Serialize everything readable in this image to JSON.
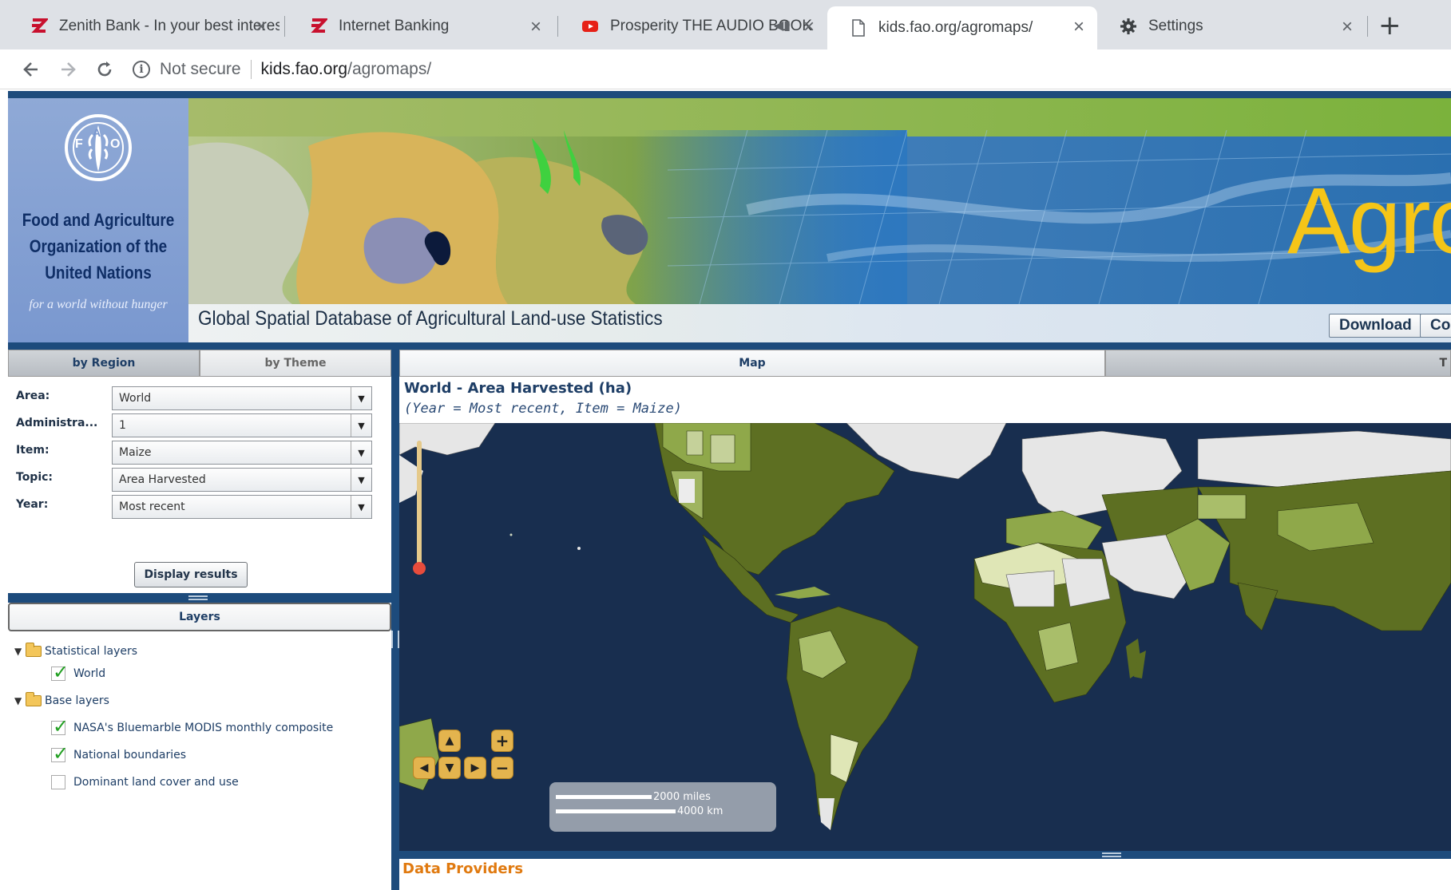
{
  "browser": {
    "tabs": [
      {
        "title": "Zenith Bank - In your best interes",
        "icon": "zenith-z-icon"
      },
      {
        "title": "Internet Banking",
        "icon": "zenith-z-icon"
      },
      {
        "title": "Prosperity THE AUDIO BOOK",
        "icon": "youtube-icon"
      },
      {
        "title": "kids.fao.org/agromaps/",
        "icon": "page-icon"
      },
      {
        "title": "Settings",
        "icon": "gear-icon"
      }
    ],
    "new_tab": "+",
    "security_label": "Not secure",
    "url_host": "kids.fao.org",
    "url_path": "/agromaps/"
  },
  "header": {
    "org_name_line1": "Food and Agriculture",
    "org_name_line2": "Organization of the",
    "org_name_line3": "United Nations",
    "tagline": "for a world without hunger",
    "logo_text": "FAO",
    "site_title_partial": "Agro",
    "subtitle": "Global Spatial Database of Agricultural Land-use Statistics",
    "buttons": {
      "download": "Download",
      "partial": "Co"
    }
  },
  "left": {
    "tabs": {
      "region": "by Region",
      "theme": "by Theme"
    },
    "form": {
      "area": {
        "label": "Area:",
        "value": "World"
      },
      "admin": {
        "label": "Administra...",
        "value": "1"
      },
      "item": {
        "label": "Item:",
        "value": "Maize"
      },
      "topic": {
        "label": "Topic:",
        "value": "Area Harvested"
      },
      "year": {
        "label": "Year:",
        "value": "Most recent"
      }
    },
    "display_button": "Display results",
    "layers_title": "Layers",
    "tree": {
      "statistical": "Statistical layers",
      "world": "World",
      "base": "Base layers",
      "bluemarble": "NASA's Bluemarble MODIS monthly composite",
      "boundaries": "National boundaries",
      "landcover": "Dominant land cover and use"
    }
  },
  "right": {
    "tabs": {
      "map": "Map",
      "partial": "T"
    },
    "map_title": "World - Area Harvested (ha)",
    "map_subtitle": "(Year = Most recent, Item = Maize)",
    "scale": {
      "miles": "2000 miles",
      "km": "4000 km"
    },
    "data_providers": "Data Providers"
  },
  "colors": {
    "accent": "#1d4b7c",
    "agro_title": "#f5c518",
    "ocean": "#152846",
    "land_dark": "#5d6f22",
    "land_mid": "#8fa84a",
    "land_light": "#dfe6b6",
    "no_data": "#e8e8e8"
  }
}
